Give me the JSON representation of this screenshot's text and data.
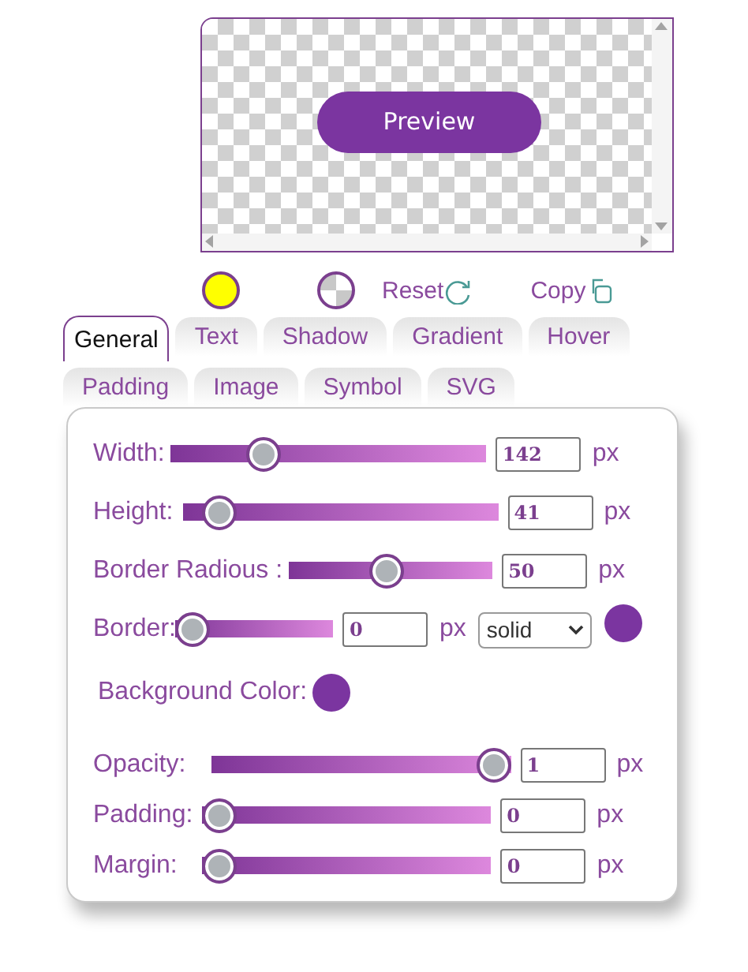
{
  "preview": {
    "button": "Preview"
  },
  "toolbar": {
    "text_color": {
      "color": "#ffff00"
    },
    "reset": "Reset",
    "copy": "Copy"
  },
  "tabs": [
    {
      "label": "General",
      "selected": true
    },
    {
      "label": "Text",
      "selected": false
    },
    {
      "label": "Shadow",
      "selected": false
    },
    {
      "label": "Gradient",
      "selected": false
    },
    {
      "label": "Hover",
      "selected": false
    },
    {
      "label": "Padding",
      "selected": false
    },
    {
      "label": "Image",
      "selected": false
    },
    {
      "label": "Symbol",
      "selected": false
    },
    {
      "label": "SVG",
      "selected": false
    }
  ],
  "controls": [
    {
      "kind": "slider",
      "label": "Width:",
      "level": 0.27,
      "value": "142",
      "unit": "px"
    },
    {
      "kind": "slider",
      "label": "Height:",
      "level": 0.07,
      "value": "41",
      "unit": "px"
    },
    {
      "kind": "slider",
      "label": "Border Radious :",
      "level": 0.48,
      "value": "50",
      "unit": "px"
    },
    {
      "kind": "border",
      "label": "Border:",
      "level": 0,
      "value": "0",
      "unit": "px",
      "style": "solid",
      "color": "#7b35a0"
    },
    {
      "kind": "color",
      "label": "Background Color:",
      "color": "#7b35a0"
    },
    {
      "kind": "slider",
      "label": "Opacity:",
      "level": 1,
      "value": "1",
      "unit": "px"
    },
    {
      "kind": "slider",
      "label": "Padding:",
      "level": 0,
      "value": "0",
      "unit": "px"
    },
    {
      "kind": "slider",
      "label": "Margin:",
      "level": 0,
      "value": "0",
      "unit": "px"
    }
  ]
}
